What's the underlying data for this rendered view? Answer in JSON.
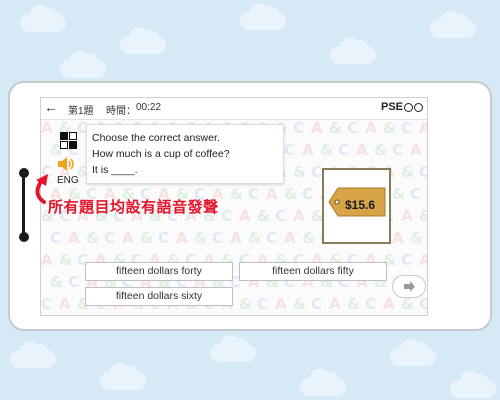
{
  "topbar": {
    "question_number": "第1題",
    "timer_label": "時間：",
    "timer_value": "00:22",
    "logo_text": "PSE"
  },
  "audio": {
    "language_label": "ENG"
  },
  "question": {
    "instruction": "Choose the correct answer.",
    "prompt": "How much is a cup of coffee?",
    "stem": "It is ____."
  },
  "price_tag": {
    "label": "$15.6"
  },
  "answers": [
    "fifteen dollars forty",
    "fifteen dollars fifty",
    "fifteen dollars sixty"
  ],
  "callout": {
    "text": "所有題目均設有語音發聲"
  },
  "colors": {
    "background": "#d6e9f7",
    "callout_red": "#e4142b",
    "tag_gold": "#d7a548"
  },
  "icons": [
    "back-arrow-icon",
    "grid-icon",
    "speaker-icon",
    "next-arrow-icon",
    "pen-icon",
    "curved-arrow-icon"
  ]
}
